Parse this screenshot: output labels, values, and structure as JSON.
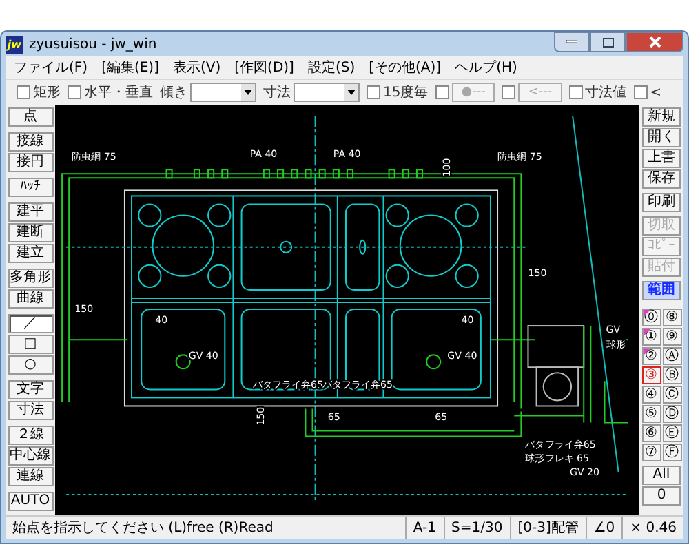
{
  "window": {
    "title": "zyusuisou - jw_win",
    "app_icon": "jw"
  },
  "menu": [
    "ファイル(F)",
    "[編集(E)]",
    "表示(V)",
    "[作図(D)]",
    "設定(S)",
    "[その他(A)]",
    "ヘルプ(H)"
  ],
  "toolbar": [
    {
      "kind": "check",
      "label": "矩形",
      "checked": false
    },
    {
      "kind": "check",
      "label": "水平・垂直",
      "checked": false
    },
    {
      "kind": "select",
      "label": "傾き"
    },
    {
      "kind": "select",
      "label": "寸法"
    },
    {
      "kind": "check",
      "label": "15度毎",
      "checked": false
    },
    {
      "kind": "checkbutton",
      "label": "●---",
      "checked": false,
      "disabled": true
    },
    {
      "kind": "checkbutton",
      "label": "<---",
      "checked": false,
      "disabled": true
    },
    {
      "kind": "check",
      "label": "寸法値",
      "checked": false
    },
    {
      "kind": "check",
      "label": "<",
      "checked": false
    }
  ],
  "left_toolbar": [
    [
      {
        "label": "点",
        "selected": false
      }
    ],
    [
      {
        "label": "接線",
        "selected": false
      },
      {
        "label": "接円",
        "selected": false
      }
    ],
    [
      {
        "label": "ﾊｯﾁ",
        "selected": false
      }
    ],
    [
      {
        "label": "建平",
        "selected": false
      },
      {
        "label": "建断",
        "selected": false
      },
      {
        "label": "建立",
        "selected": false
      }
    ],
    [
      {
        "label": "多角形",
        "selected": false
      },
      {
        "label": "曲線",
        "selected": false
      }
    ],
    [
      {
        "label": "／",
        "selected": true
      },
      {
        "label": "□",
        "selected": false
      },
      {
        "label": "○",
        "selected": false
      }
    ],
    [
      {
        "label": "文字",
        "selected": false
      },
      {
        "label": "寸法",
        "selected": false
      }
    ],
    [
      {
        "label": "２線",
        "selected": false
      },
      {
        "label": "中心線",
        "selected": false
      },
      {
        "label": "連線",
        "selected": false
      }
    ],
    [
      {
        "label": "AUTO",
        "selected": false
      }
    ]
  ],
  "right_toolbar": [
    [
      {
        "label": "新規",
        "disabled": false,
        "active": false
      },
      {
        "label": "開く",
        "disabled": false,
        "active": false
      },
      {
        "label": "上書",
        "disabled": false,
        "active": false
      },
      {
        "label": "保存",
        "disabled": false,
        "active": false
      }
    ],
    [
      {
        "label": "印刷",
        "disabled": false,
        "active": false
      }
    ],
    [
      {
        "label": "切取",
        "disabled": true,
        "active": false
      },
      {
        "label": "ｺﾋﾟｰ",
        "disabled": true,
        "active": false
      },
      {
        "label": "貼付",
        "disabled": true,
        "active": false
      }
    ],
    [
      {
        "label": "範囲",
        "disabled": false,
        "active": true
      }
    ]
  ],
  "layers": [
    {
      "label": "⓪",
      "selected": false,
      "marked": true
    },
    {
      "label": "⑧",
      "selected": false,
      "marked": false
    },
    {
      "label": "①",
      "selected": false,
      "marked": true
    },
    {
      "label": "⑨",
      "selected": false,
      "marked": false
    },
    {
      "label": "②",
      "selected": false,
      "marked": true
    },
    {
      "label": "Ⓐ",
      "selected": false,
      "marked": false
    },
    {
      "label": "③",
      "selected": true,
      "marked": false
    },
    {
      "label": "Ⓑ",
      "selected": false,
      "marked": false
    },
    {
      "label": "④",
      "selected": false,
      "marked": false
    },
    {
      "label": "Ⓒ",
      "selected": false,
      "marked": false
    },
    {
      "label": "⑤",
      "selected": false,
      "marked": false
    },
    {
      "label": "Ⓓ",
      "selected": false,
      "marked": false
    },
    {
      "label": "⑥",
      "selected": false,
      "marked": false
    },
    {
      "label": "Ⓔ",
      "selected": false,
      "marked": false
    },
    {
      "label": "⑦",
      "selected": false,
      "marked": false
    },
    {
      "label": "Ⓕ",
      "selected": false,
      "marked": false
    }
  ],
  "layer_buttons": [
    "All",
    "0"
  ],
  "canvas": {
    "labels": [
      {
        "text": "防虫網 75",
        "kind": "horizontal"
      },
      {
        "text": "PA 40",
        "kind": "horizontal"
      },
      {
        "text": "PA 40",
        "kind": "horizontal"
      },
      {
        "text": "防虫網 75",
        "kind": "horizontal"
      },
      {
        "text": "100",
        "kind": "vertical"
      },
      {
        "text": "150",
        "kind": "horizontal"
      },
      {
        "text": "150",
        "kind": "horizontal"
      },
      {
        "text": "40",
        "kind": "horizontal"
      },
      {
        "text": "40",
        "kind": "horizontal"
      },
      {
        "text": "GV 40",
        "kind": "horizontal"
      },
      {
        "text": "GV 40",
        "kind": "horizontal"
      },
      {
        "text": "GV",
        "kind": "horizontal"
      },
      {
        "text": "球形",
        "kind": "horizontal"
      },
      {
        "text": "バタフライ弁65",
        "kind": "horizontal"
      },
      {
        "text": "バタフライ弁65",
        "kind": "horizontal"
      },
      {
        "text": "150",
        "kind": "vertical"
      },
      {
        "text": "65",
        "kind": "horizontal"
      },
      {
        "text": "65",
        "kind": "horizontal"
      },
      {
        "text": "バタフライ弁65",
        "kind": "horizontal"
      },
      {
        "text": "球形フレキ 65",
        "kind": "horizontal"
      },
      {
        "text": "GV 20",
        "kind": "horizontal"
      }
    ]
  },
  "status_bar": [
    "始点を指示してください (L)free (R)Read",
    "A-1",
    "S=1/30",
    "[0-3]配管",
    "∠0",
    "× 0.46"
  ]
}
